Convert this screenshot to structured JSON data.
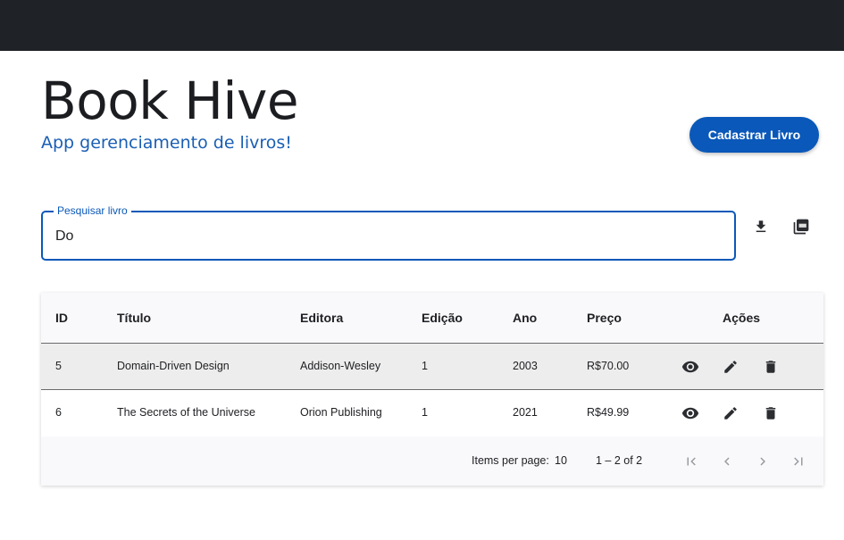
{
  "header": {
    "title": "Book Hive",
    "subtitle": "App gerenciamento de livros!",
    "register_button": "Cadastrar Livro"
  },
  "search": {
    "label": "Pesquisar livro",
    "value": "Do"
  },
  "toolbar_icons": [
    "download-icon",
    "pdf-icon"
  ],
  "table": {
    "columns": [
      "ID",
      "Título",
      "Editora",
      "Edição",
      "Ano",
      "Preço",
      "Ações"
    ],
    "rows": [
      {
        "id": "5",
        "titulo": "Domain-Driven Design",
        "editora": "Addison-Wesley",
        "edicao": "1",
        "ano": "2003",
        "preco": "R$70.00"
      },
      {
        "id": "6",
        "titulo": "The Secrets of the Universe",
        "editora": "Orion Publishing",
        "edicao": "1",
        "ano": "2021",
        "preco": "R$49.99"
      }
    ],
    "row_actions": [
      "view-icon",
      "edit-icon",
      "delete-icon"
    ]
  },
  "paginator": {
    "items_per_page_label": "Items per page:",
    "items_per_page_value": "10",
    "range_label": "1 – 2 of 2"
  },
  "colors": {
    "topbar": "#1f2227",
    "primary": "#0a58b9",
    "subtitle": "#1a5fb4"
  }
}
